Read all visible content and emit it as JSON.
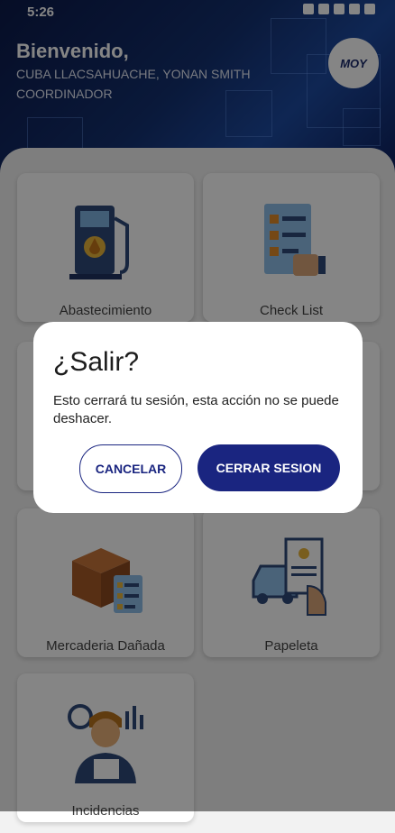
{
  "status_bar": {
    "time": "5:26"
  },
  "header": {
    "greeting": "Bienvenido,",
    "user_name": "CUBA LLACSAHUACHE, YONAN SMITH",
    "role": "COORDINADOR",
    "logo_text": "MOY"
  },
  "menu": [
    {
      "label": "Abastecimiento",
      "icon": "fuel-pump-icon"
    },
    {
      "label": "Check List",
      "icon": "checklist-icon"
    },
    {
      "label": "",
      "icon": ""
    },
    {
      "label": "",
      "icon": ""
    },
    {
      "label": "Mercaderia Dañada",
      "icon": "damaged-box-icon"
    },
    {
      "label": "Papeleta",
      "icon": "traffic-ticket-icon"
    },
    {
      "label": "Incidencias",
      "icon": "incident-person-icon"
    }
  ],
  "dialog": {
    "title": "¿Salir?",
    "message": "Esto cerrará tu sesión, esta acción no se puede deshacer.",
    "cancel_label": "CANCELAR",
    "confirm_label": "CERRAR SESION"
  },
  "colors": {
    "primary": "#1a2580",
    "header_bg": "#14306f"
  }
}
